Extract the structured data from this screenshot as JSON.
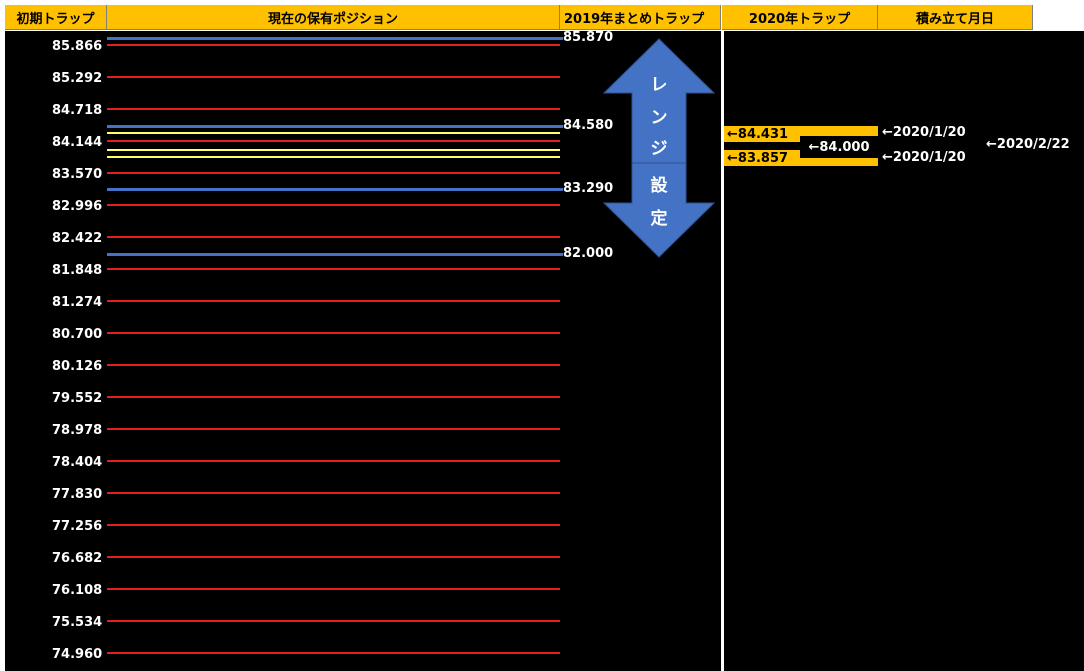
{
  "headers": {
    "initial_trap": "初期トラップ",
    "current_positions": "現在の保有ポジション",
    "trap_2019": "2019年まとめトラップ",
    "trap_2020": "2020年トラップ",
    "accumulation_date": "積み立て月日"
  },
  "ticks": [
    "85.866",
    "85.292",
    "84.718",
    "84.144",
    "83.570",
    "82.996",
    "82.422",
    "81.848",
    "81.274",
    "80.700",
    "80.126",
    "79.552",
    "78.978",
    "78.404",
    "77.830",
    "77.256",
    "76.682",
    "76.108",
    "75.534",
    "74.960"
  ],
  "trap_2019_values": [
    "85.870",
    "84.580",
    "83.290",
    "82.000"
  ],
  "range_setting": [
    "レ",
    "ン",
    "ジ",
    "設",
    "定"
  ],
  "trap_2020": {
    "upper": "←84.431",
    "lower": "←83.857",
    "center": "←84.000"
  },
  "accumulation": {
    "upper_date": "←2020/1/20",
    "lower_date": "←2020/1/20",
    "center_date": "←2020/2/22"
  },
  "colors": {
    "header_bg": "#ffc000",
    "grid_bg": "#000000",
    "trap_line_red": "#e02020",
    "trap_line_blue": "#4472c4",
    "trap_line_yellow": "#ffff66",
    "arrow_blue": "#4472c4"
  }
}
